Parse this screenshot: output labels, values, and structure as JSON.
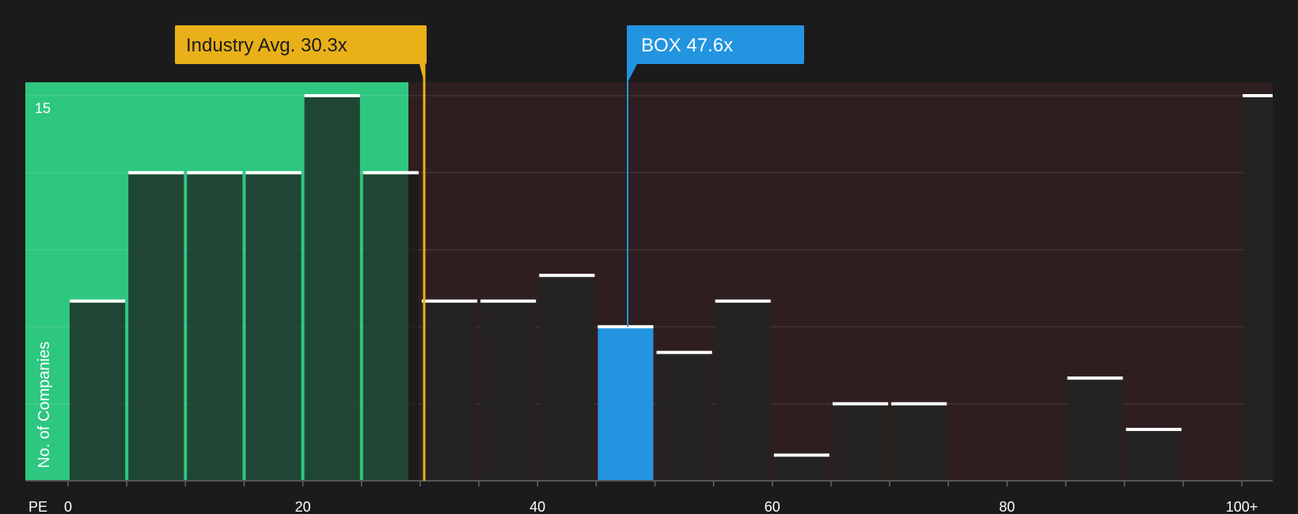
{
  "chart_data": {
    "type": "bar",
    "x_axis_label": "PE",
    "y_axis_label": "No. of Companies",
    "x_ticks": [
      "0",
      "20",
      "40",
      "60",
      "80",
      "100+"
    ],
    "y_tick_labels": [
      "15"
    ],
    "ylim": [
      0,
      15.5
    ],
    "grid": true,
    "bin_width": 5,
    "bins": [
      {
        "x0": 0,
        "value": 7
      },
      {
        "x0": 5,
        "value": 12
      },
      {
        "x0": 10,
        "value": 12
      },
      {
        "x0": 15,
        "value": 12
      },
      {
        "x0": 20,
        "value": 15
      },
      {
        "x0": 25,
        "value": 12
      },
      {
        "x0": 30,
        "value": 7
      },
      {
        "x0": 35,
        "value": 7
      },
      {
        "x0": 40,
        "value": 8
      },
      {
        "x0": 45,
        "value": 6,
        "highlight": true
      },
      {
        "x0": 50,
        "value": 5
      },
      {
        "x0": 55,
        "value": 7
      },
      {
        "x0": 60,
        "value": 1
      },
      {
        "x0": 65,
        "value": 3
      },
      {
        "x0": 70,
        "value": 3
      },
      {
        "x0": 75,
        "value": 0
      },
      {
        "x0": 80,
        "value": 0
      },
      {
        "x0": 85,
        "value": 4
      },
      {
        "x0": 90,
        "value": 2
      },
      {
        "x0": 95,
        "value": 0
      },
      {
        "x0": 100,
        "value": 15,
        "overflow": true
      }
    ],
    "industry_avg": {
      "label": "Industry Avg. 30.3x",
      "value": 30.3
    },
    "company": {
      "label": "BOX 47.6x",
      "value": 47.6
    },
    "colors": {
      "good_zone": "#2ec77f",
      "bad_zone": "#2f1e1f",
      "bar": "#232323",
      "highlight_bar": "#2394e0",
      "industry": "#eab01a",
      "company": "#2394e0",
      "cap": "#ffffff"
    }
  }
}
